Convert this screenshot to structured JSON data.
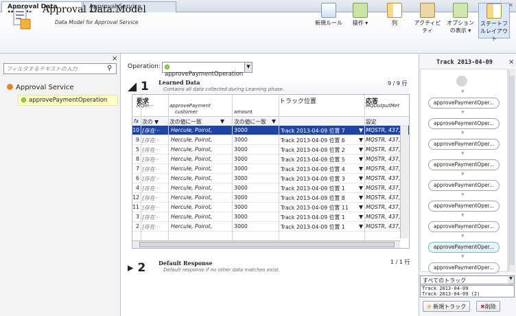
{
  "tabs": [
    {
      "label": "Approval Data Model*"
    },
    {
      "label": "Approval Service Description"
    }
  ],
  "window_controls": "▼ ×",
  "header": {
    "title": "Approval Data Model",
    "subtitle": "Data Model for Approval Service",
    "toolbar": [
      {
        "label": "新規ルール",
        "icon": "new-rule-icon"
      },
      {
        "label": "操作 ▾",
        "icon": "operation-icon"
      },
      {
        "label": "列",
        "icon": "column-icon"
      },
      {
        "label": "アクティビティ",
        "icon": "activity-icon"
      },
      {
        "label": "オプションの表示 ▾",
        "icon": "options-icon"
      },
      {
        "label": "ステートフルレイアウト",
        "icon": "stateful-layout-icon"
      }
    ]
  },
  "left": {
    "filter_placeholder": "フィルタするテキストの入力",
    "tree_root": "Approval Service",
    "tree_op": "approvePaymentOperation"
  },
  "operation": {
    "label": "Operation:",
    "value": "approvePaymentOperation"
  },
  "section1": {
    "number": "1",
    "title": "Learned Data",
    "desc": "Contains all data collected during Learning phase.",
    "count": "9 / 9 行",
    "headers": {
      "request": "要求",
      "mq": "MQIn···",
      "approve": "approvePayment",
      "customer": "customer",
      "amount": "amount",
      "track": "トラック位置",
      "response": "応答",
      "mqout": "MQOutputMet"
    },
    "filter_row": {
      "fx": "fx",
      "c1": "次の ▼",
      "c2": "次の値に一致",
      "c3": "次の値に一致",
      "c5": "設定"
    },
    "rows": [
      {
        "id": "10",
        "mq": "[存在···",
        "cust": "Hercule, Poirot,",
        "amt": "3000",
        "track": "Track 2013-04-09 位置 7",
        "resp": "MQSTR, 437, ·"
      },
      {
        "id": "9",
        "mq": "[存在···",
        "cust": "Hercule, Poirot,",
        "amt": "3000",
        "track": "Track 2013-04-09 位置 6",
        "resp": "MQSTR, 437, ·"
      },
      {
        "id": "5",
        "mq": "[存在···",
        "cust": "Hercule, Poirot,",
        "amt": "3000",
        "track": "Track 2013-04-09 位置 2",
        "resp": "MQSTR, 437, ·"
      },
      {
        "id": "8",
        "mq": "[存在···",
        "cust": "Hercule, Poirot,",
        "amt": "3000",
        "track": "Track 2013-04-09 位置 5",
        "resp": "MQSTR, 437, ·"
      },
      {
        "id": "7",
        "mq": "[存在···",
        "cust": "Hercule, Poirot,",
        "amt": "3000",
        "track": "Track 2013-04-09 位置 4",
        "resp": "MQSTR, 437, ·"
      },
      {
        "id": "6",
        "mq": "[存在···",
        "cust": "Hercule, Poirot,",
        "amt": "3000",
        "track": "Track 2013-04-09 位置 3",
        "resp": "MQSTR, 437, ·"
      },
      {
        "id": "4",
        "mq": "[存在···",
        "cust": "Hercule, Poirot,",
        "amt": "3000",
        "track": "Track 2013-04-09 位置 1",
        "resp": "MQSTR, 437, ·"
      },
      {
        "id": "12",
        "mq": "[存在···",
        "cust": "Hercule, Poirot,",
        "amt": "3000",
        "track": "Track 2013-04-09 位置 8",
        "resp": "MQSTR, 437, ·"
      },
      {
        "id": "11",
        "mq": "[存在···",
        "cust": "Hercule, Poirot,",
        "amt": "3000",
        "track": "Track 2013-04-09 位置 11",
        "resp": "MQSTR, 437, ·"
      },
      {
        "id": "3",
        "mq": "[存在···",
        "cust": "Hercule, Poirot,",
        "amt": "3000",
        "track": "Track 2013-04-09 位置 1",
        "resp": "MQSTR, 437, ·"
      },
      {
        "id": "2",
        "mq": "[存在···",
        "cust": "Hercule, Poirot,",
        "amt": "3000",
        "track": "Track 2013-04-09 位置 1",
        "resp": "MQSTR, 437, ·"
      }
    ]
  },
  "section2": {
    "number": "2",
    "title": "Default Response",
    "desc": "Default response if no other data matches exist.",
    "count": "1 / 1 行"
  },
  "right": {
    "title": "Track 2013-04-09",
    "nodes": [
      "approvePaymentOper...",
      "approvePaymentOper...",
      "approvePaymentOper...",
      "approvePaymentOper...",
      "approvePaymentOper...",
      "approvePaymentOper...",
      "approvePaymentOper...",
      "approvePaymentOper...",
      "approvePaymentOper..."
    ],
    "track_select": "すべてのトラック",
    "track_list": [
      "Track 2013-04-09",
      "Track 2013-04-09 (2)"
    ],
    "new_track": "新規トラック",
    "delete": "削除"
  }
}
